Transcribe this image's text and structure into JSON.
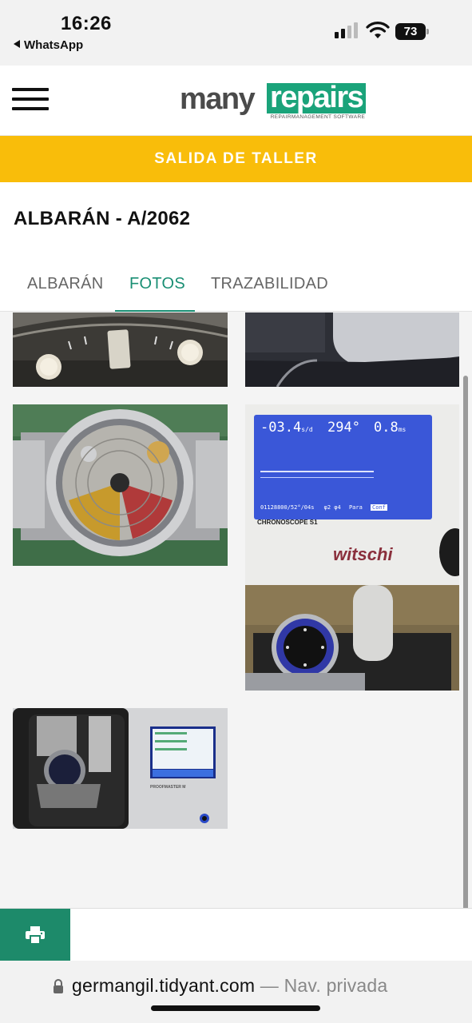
{
  "status_bar": {
    "time": "16:26",
    "back_app": "WhatsApp",
    "battery": "73",
    "icons": [
      "cellular-signal-icon",
      "wifi-icon",
      "battery-icon"
    ]
  },
  "header": {
    "logo_many": "many",
    "logo_repairs": "repairs",
    "logo_tagline": "REPAIRMANAGEMENT SOFTWARE",
    "colors": {
      "brand_green": "#1aa37a",
      "logo_gray": "#4a4a4a"
    }
  },
  "banner": {
    "label": "SALIDA DE TALLER",
    "color": "#f9bd0a"
  },
  "document": {
    "title": "ALBARÁN - A/2062"
  },
  "tabs": [
    {
      "label": "ALBARÁN",
      "active": false
    },
    {
      "label": "FOTOS",
      "active": true
    },
    {
      "label": "TRAZABILIDAD",
      "active": false
    }
  ],
  "gallery": {
    "photos": [
      {
        "subject": "watch dial close-up"
      },
      {
        "subject": "watch strap detail"
      },
      {
        "subject": "watch movement, caseback open"
      },
      {
        "subject": "timegrapher measurement",
        "readout": "-03.4",
        "readout_unit": "s/d",
        "amplitude": "294°",
        "beat_error": "0.8",
        "beat_unit": "ms",
        "footer_text": "01128800/52°/04s",
        "positions": "φ2  φ4",
        "mode_label": "Para",
        "button_label": "Conf",
        "device_label": "CHRONOSCOPE S1",
        "brand_label": "witschi"
      },
      {
        "subject": "pressure test machine",
        "device_label": "PROOFMASTER M"
      }
    ]
  },
  "bottom_bar": {
    "print_icon": "printer-icon",
    "color": "#1d8a6a"
  },
  "url_bar": {
    "url": "germangil.tidyant.com",
    "separator": " — ",
    "mode": "Nav. privada"
  }
}
